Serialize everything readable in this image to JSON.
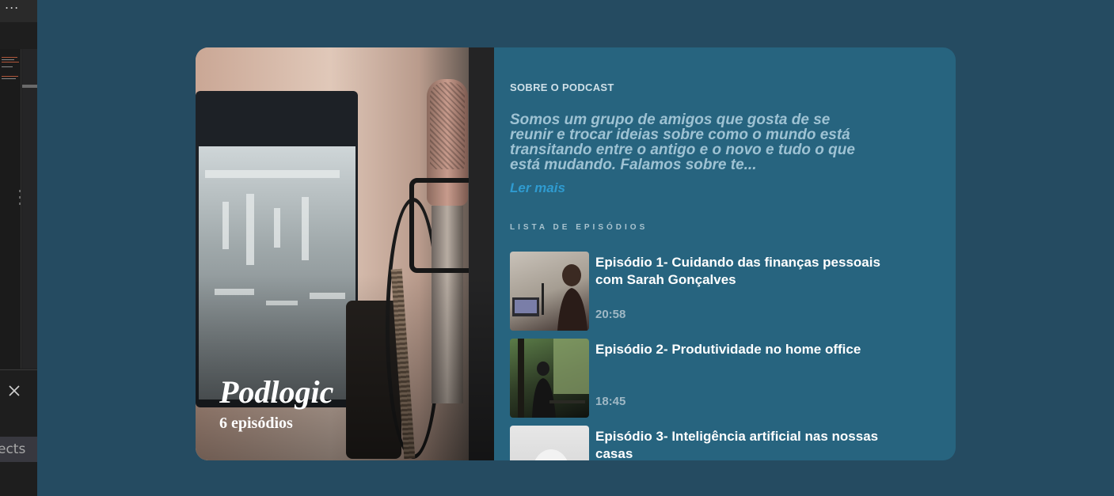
{
  "sidebar": {
    "menu_dots": "...",
    "tab_snippet": "ects"
  },
  "podcast": {
    "title": "Podlogic",
    "episode_count": "6 episódios"
  },
  "about": {
    "label": "SOBRE O PODCAST",
    "description": "Somos um grupo de amigos que gosta de se reunir e trocar ideias sobre como o mundo está transitando entre o antigo e o novo e tudo o que está mudando. Falamos sobre te...",
    "read_more": "Ler mais"
  },
  "episodes": {
    "label": "LISTA DE EPISÓDIOS",
    "items": [
      {
        "title": "Episódio 1- Cuidando das finanças pessoais com Sarah Gonçalves",
        "duration": "20:58"
      },
      {
        "title": "Episódio 2- Produtividade no home office",
        "duration": "18:45"
      },
      {
        "title": "Episódio 3- Inteligência artificial nas nossas casas",
        "duration": ""
      }
    ]
  },
  "colors": {
    "page_bg": "#254b61",
    "card_bg": "#27647f",
    "accent_link": "#2f9bd0"
  }
}
